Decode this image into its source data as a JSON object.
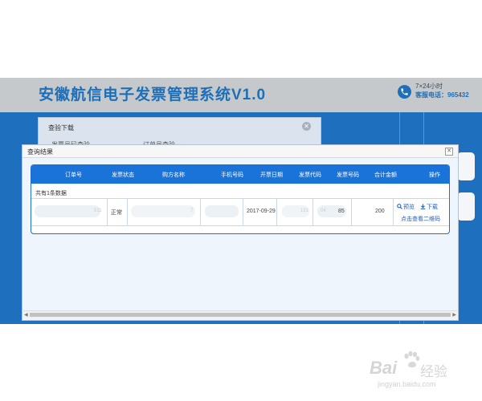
{
  "header": {
    "title": "安徽航信电子发票管理系统V1.0",
    "service_hours": "7×24小时",
    "service_phone": "客服电话：965432"
  },
  "under_dialog": {
    "title": "查验下载",
    "tab_a": "发票号码查验",
    "tab_b": "订单号查验"
  },
  "modal": {
    "title": "查询结果",
    "columns": [
      "订单号",
      "发票状态",
      "购方名称",
      "手机号码",
      "开票日期",
      "发票代码",
      "发票号码",
      "合计金额",
      "操作"
    ],
    "record_count": "共有1条数据",
    "row": {
      "order_no_fragment": "511",
      "status": "正常",
      "buyer_fragment": "7",
      "invoice_date": "2017-09-29",
      "code_fragment": "191",
      "number_fragment_a": "04",
      "number_fragment_b": "85",
      "total": "200"
    },
    "actions": {
      "preview": "预览",
      "download": "下载",
      "qr": "点击查看二维码"
    }
  },
  "watermark": {
    "brand": "Bai",
    "experience": "经验",
    "url": "jingyan.baidu.com"
  },
  "colors": {
    "brand_blue": "#1e6fb8",
    "table_header": "#1a73d9",
    "page_blue": "#1f6fbf"
  }
}
